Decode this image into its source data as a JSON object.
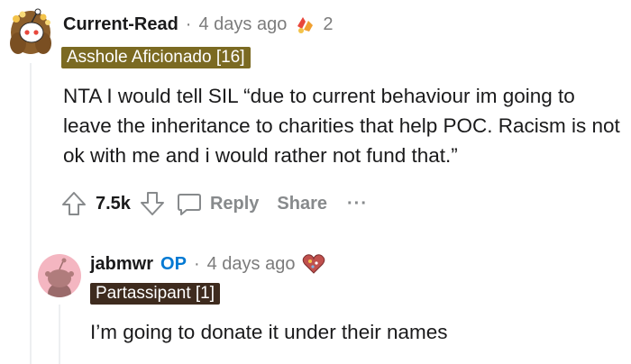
{
  "comment": {
    "username": "Current-Read",
    "separator": "·",
    "time": "4 days ago",
    "award_count": "2",
    "flair": "Asshole Aficionado [16]",
    "body": "NTA I would tell SIL “due to current behaviour im going to leave the inheritance to charities that help POC. Racism is not ok with me and i would rather not fund that.”",
    "score": "7.5k",
    "reply_label": "Reply",
    "share_label": "Share",
    "more_label": "···"
  },
  "reply": {
    "username": "jabmwr",
    "op_label": "OP",
    "separator": "·",
    "time": "4 days ago",
    "flair": "Partassipant [1]",
    "body": "I’m going to donate it under their names"
  },
  "colors": {
    "flair_1": "#7b6a22",
    "flair_2": "#3e2b1e",
    "op_blue": "#0079d3",
    "meta_gray": "#7c7c7c"
  }
}
